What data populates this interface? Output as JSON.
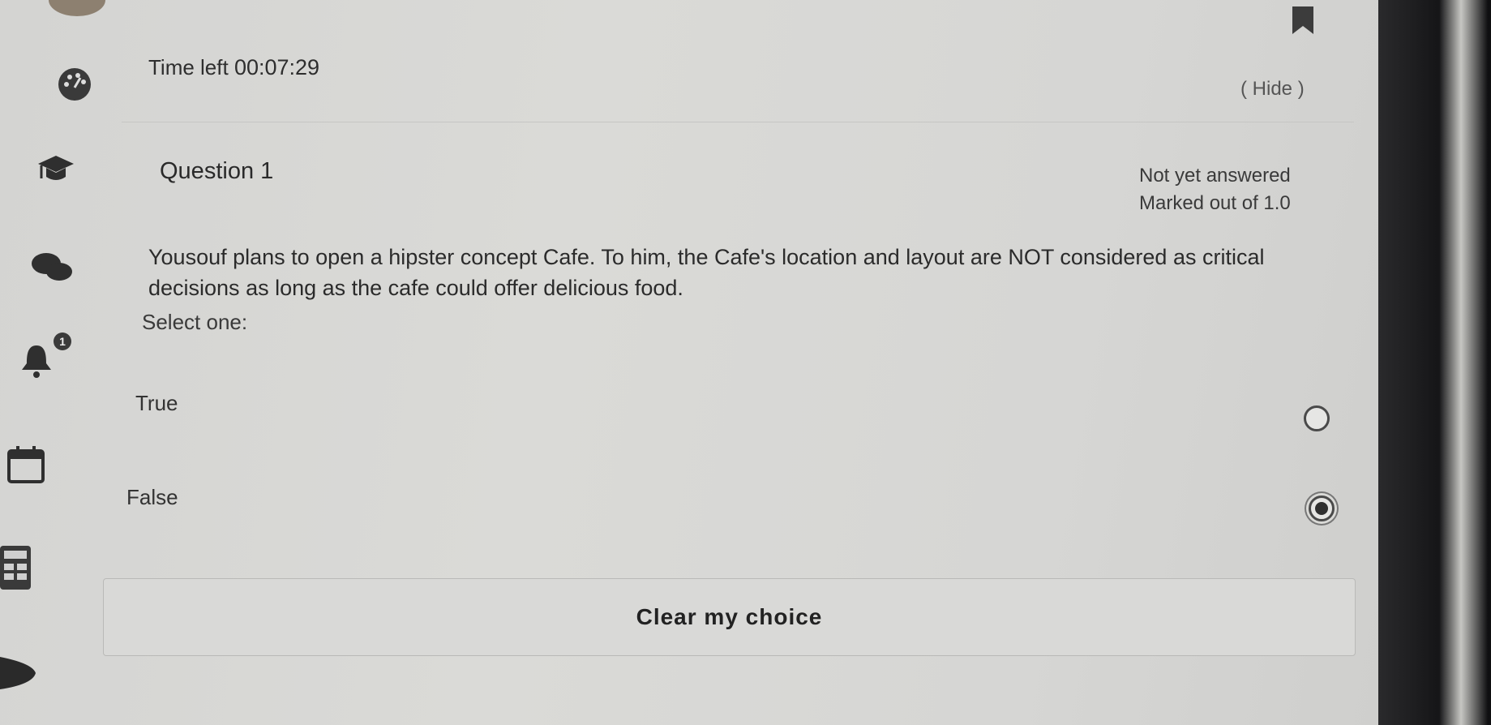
{
  "timer": {
    "label": "Time left",
    "value": "00:07:29"
  },
  "hide_label": "( Hide )",
  "question": {
    "number_label": "Question 1",
    "status": "Not yet answered",
    "marks": "Marked out of 1.0",
    "text": "Yousouf plans to open a hipster concept Cafe. To him,  the Cafe's location and layout are NOT considered as critical decisions as long as the cafe could offer delicious food.",
    "prompt": "Select one:",
    "options": [
      {
        "label": "True",
        "selected": false
      },
      {
        "label": "False",
        "selected": true
      }
    ]
  },
  "clear_label": "Clear my choice",
  "sidebar": {
    "notification_count": "1",
    "icons": [
      "dashboard-icon",
      "graduation-cap-icon",
      "messages-icon",
      "bell-icon",
      "calendar-icon",
      "calculator-icon",
      "chevron-icon"
    ]
  },
  "colors": {
    "screen_bg": "#d8d8d6",
    "text": "#2b2b2b",
    "bezel": "#151517"
  }
}
